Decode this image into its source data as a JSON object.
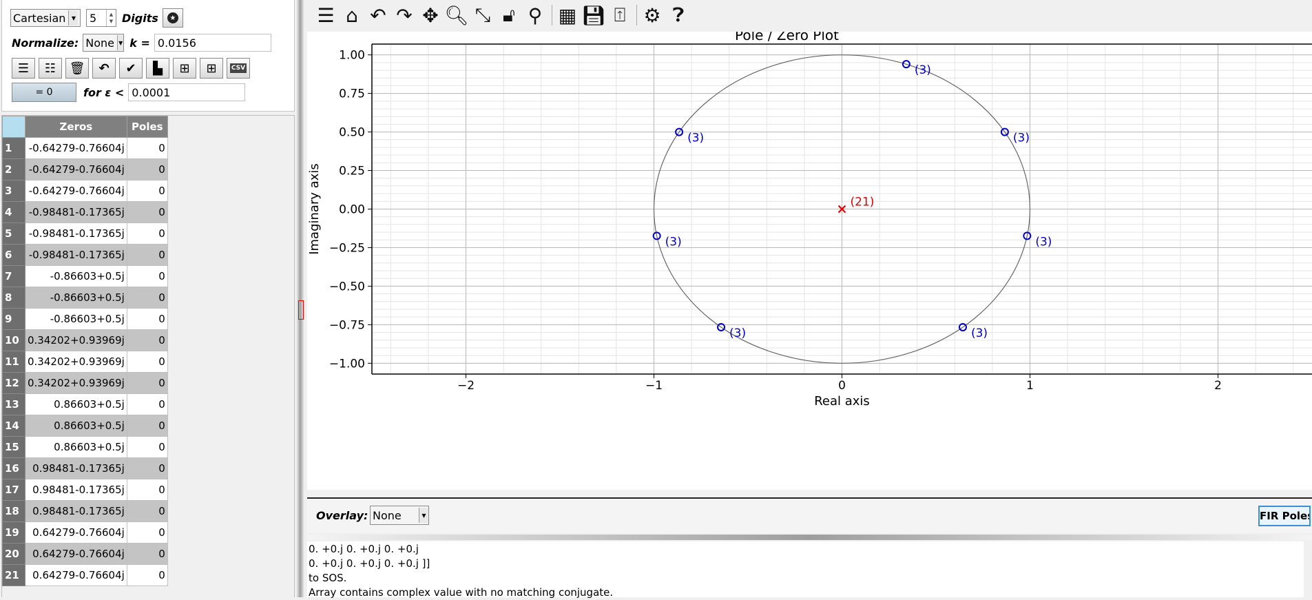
{
  "controls": {
    "format_value": "Cartesian",
    "digits_value": "5",
    "digits_label": "Digits",
    "normalize_label": "Normalize:",
    "normalize_value": "None",
    "k_label": "k =",
    "k_value": "0.0156",
    "eq_zero_label": "= 0",
    "eps_label": "for ε <",
    "eps_value": "0.0001",
    "csv_label": "CSV"
  },
  "table": {
    "headers": [
      "Zeros",
      "Poles"
    ],
    "rows": [
      {
        "n": "1",
        "zero": "-0.64279-0.76604j",
        "pole": "0"
      },
      {
        "n": "2",
        "zero": "-0.64279-0.76604j",
        "pole": "0"
      },
      {
        "n": "3",
        "zero": "-0.64279-0.76604j",
        "pole": "0"
      },
      {
        "n": "4",
        "zero": "-0.98481-0.17365j",
        "pole": "0"
      },
      {
        "n": "5",
        "zero": "-0.98481-0.17365j",
        "pole": "0"
      },
      {
        "n": "6",
        "zero": "-0.98481-0.17365j",
        "pole": "0"
      },
      {
        "n": "7",
        "zero": "-0.86603+0.5j",
        "pole": "0"
      },
      {
        "n": "8",
        "zero": "-0.86603+0.5j",
        "pole": "0"
      },
      {
        "n": "9",
        "zero": "-0.86603+0.5j",
        "pole": "0"
      },
      {
        "n": "10",
        "zero": "0.34202+0.93969j",
        "pole": "0"
      },
      {
        "n": "11",
        "zero": "0.34202+0.93969j",
        "pole": "0"
      },
      {
        "n": "12",
        "zero": "0.34202+0.93969j",
        "pole": "0"
      },
      {
        "n": "13",
        "zero": "0.86603+0.5j",
        "pole": "0"
      },
      {
        "n": "14",
        "zero": "0.86603+0.5j",
        "pole": "0"
      },
      {
        "n": "15",
        "zero": "0.86603+0.5j",
        "pole": "0"
      },
      {
        "n": "16",
        "zero": "0.98481-0.17365j",
        "pole": "0"
      },
      {
        "n": "17",
        "zero": "0.98481-0.17365j",
        "pole": "0"
      },
      {
        "n": "18",
        "zero": "0.98481-0.17365j",
        "pole": "0"
      },
      {
        "n": "19",
        "zero": "0.64279-0.76604j",
        "pole": "0"
      },
      {
        "n": "20",
        "zero": "0.64279-0.76604j",
        "pole": "0"
      },
      {
        "n": "21",
        "zero": "0.64279-0.76604j",
        "pole": "0"
      }
    ]
  },
  "chart_data": {
    "type": "scatter",
    "title": "Pole / Zero Plot",
    "xlabel": "Real axis",
    "ylabel": "Imaginary axis",
    "xlim": [
      -2.5,
      2.5
    ],
    "ylim": [
      -1.07,
      1.07
    ],
    "xticks": [
      -2,
      -1,
      0,
      1,
      2
    ],
    "yticks": [
      1.0,
      0.75,
      0.5,
      0.25,
      0.0,
      -0.25,
      -0.5,
      -0.75,
      -1.0
    ],
    "xtick_labels": [
      "−2",
      "−1",
      "0",
      "1",
      "2"
    ],
    "ytick_labels": [
      "1.00",
      "0.75",
      "0.50",
      "0.25",
      "0.00",
      "−0.25",
      "−0.50",
      "−0.75",
      "−1.00"
    ],
    "grid": true,
    "unit_circle": true,
    "zeros": [
      {
        "re": 0.34202,
        "im": 0.93969,
        "label": "(3)"
      },
      {
        "re": -0.86603,
        "im": 0.5,
        "label": "(3)"
      },
      {
        "re": 0.86603,
        "im": 0.5,
        "label": "(3)"
      },
      {
        "re": -0.98481,
        "im": -0.17365,
        "label": "(3)"
      },
      {
        "re": 0.98481,
        "im": -0.17365,
        "label": "(3)"
      },
      {
        "re": -0.64279,
        "im": -0.76604,
        "label": "(3)"
      },
      {
        "re": 0.64279,
        "im": -0.76604,
        "label": "(3)"
      }
    ],
    "poles": [
      {
        "re": 0,
        "im": 0,
        "label": "(21)"
      }
    ],
    "zero_color": "#0000cc",
    "pole_color": "#dd0000"
  },
  "overlay": {
    "label": "Overlay:",
    "value": "None",
    "fir_button": "FIR Poles"
  },
  "console": {
    "lines": [
      "0.  +0.j 0.  +0.j 0.  +0.j",
      "0.  +0.j 0.  +0.j 0.  +0.j ]]",
      "to SOS.",
      "Array contains complex value with no matching conjugate."
    ]
  },
  "toolbar_icons": [
    "layout-icon",
    "home-icon",
    "undo-icon",
    "redo-icon",
    "pan-icon",
    "zoom-icon",
    "autoscale-icon",
    "lock-icon",
    "marker-icon",
    "grid-icon",
    "save-icon",
    "export-icon",
    "settings-icon",
    "help-icon"
  ]
}
